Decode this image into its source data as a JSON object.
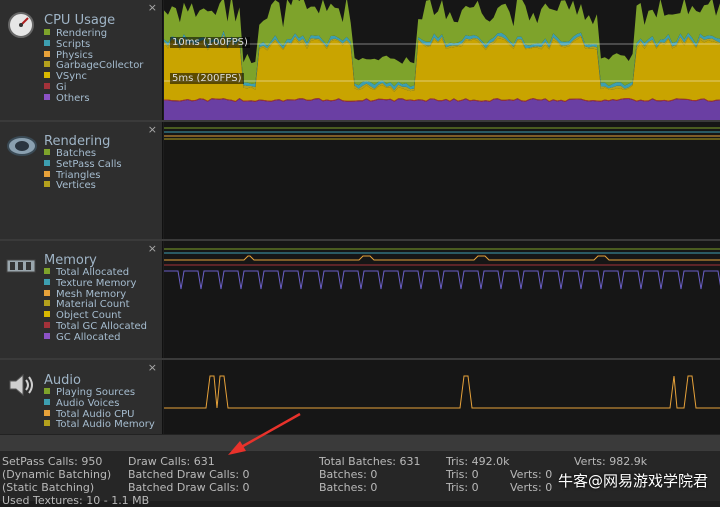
{
  "cpu": {
    "title": "CPU Usage",
    "close": "×",
    "legend": [
      {
        "label": "Rendering",
        "color": "#7ea32b"
      },
      {
        "label": "Scripts",
        "color": "#3d9fb1"
      },
      {
        "label": "Physics",
        "color": "#e7a23a"
      },
      {
        "label": "GarbageCollector",
        "color": "#b4a11d"
      },
      {
        "label": "VSync",
        "color": "#d8b800"
      },
      {
        "label": "Gi",
        "color": "#a3323a"
      },
      {
        "label": "Others",
        "color": "#8c52c6"
      }
    ],
    "marker_10ms": "10ms (100FPS)",
    "marker_5ms": "5ms (200FPS)"
  },
  "rendering": {
    "title": "Rendering",
    "close": "×",
    "legend": [
      {
        "label": "Batches",
        "color": "#7ea32b"
      },
      {
        "label": "SetPass Calls",
        "color": "#3d9fb1"
      },
      {
        "label": "Triangles",
        "color": "#e7a23a"
      },
      {
        "label": "Vertices",
        "color": "#b4a11d"
      }
    ]
  },
  "memory": {
    "title": "Memory",
    "close": "×",
    "legend": [
      {
        "label": "Total Allocated",
        "color": "#7ea32b"
      },
      {
        "label": "Texture Memory",
        "color": "#3d9fb1"
      },
      {
        "label": "Mesh Memory",
        "color": "#e7a23a"
      },
      {
        "label": "Material Count",
        "color": "#b4a11d"
      },
      {
        "label": "Object Count",
        "color": "#d8b800"
      },
      {
        "label": "Total GC Allocated",
        "color": "#a3323a"
      },
      {
        "label": "GC Allocated",
        "color": "#8c52c6"
      }
    ]
  },
  "audio": {
    "title": "Audio",
    "close": "×",
    "legend": [
      {
        "label": "Playing Sources",
        "color": "#7ea32b"
      },
      {
        "label": "Audio Voices",
        "color": "#3d9fb1"
      },
      {
        "label": "Total Audio CPU",
        "color": "#e7a23a"
      },
      {
        "label": "Total Audio Memory",
        "color": "#b4a11d"
      }
    ]
  },
  "stats": {
    "setpass": "SetPass Calls: 950",
    "dynamic": "(Dynamic Batching)",
    "static": "(Static Batching)",
    "used_textures": "Used Textures: 10 - 1.1 MB",
    "draw_calls": "Draw Calls: 631",
    "batched_1": "Batched Draw Calls: 0",
    "batched_2": "Batched Draw Calls: 0",
    "total_batches": "Total Batches: 631",
    "batches_1": "Batches: 0",
    "batches_2": "Batches: 0",
    "tris": "Tris: 492.0k",
    "tris_1": "Tris: 0",
    "tris_2": "Tris: 0",
    "verts": "Verts: 982.9k",
    "verts_1": "Verts: 0",
    "verts_2": "Verts: 0"
  },
  "watermark": "牛客@网易游戏学院君",
  "colors": {
    "annotation_arrow": "#e8322b"
  }
}
